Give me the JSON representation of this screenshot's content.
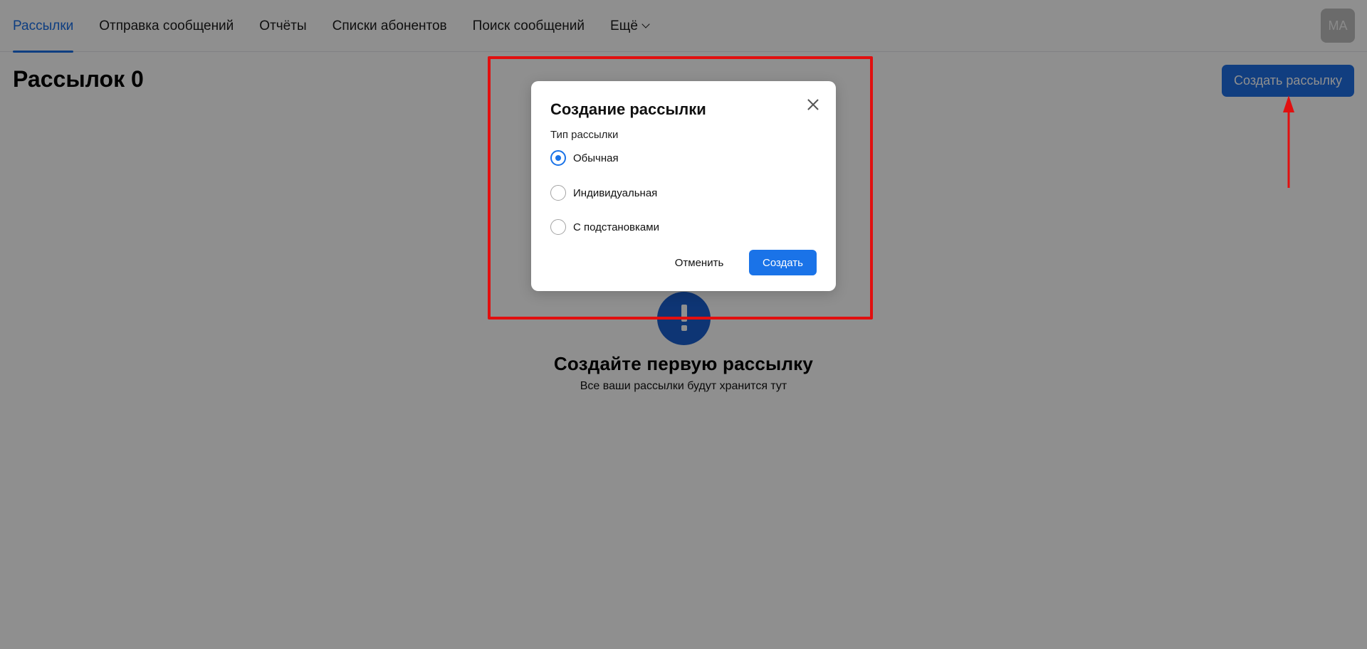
{
  "nav": {
    "tabs": [
      {
        "label": "Рассылки",
        "active": true
      },
      {
        "label": "Отправка сообщений"
      },
      {
        "label": "Отчёты"
      },
      {
        "label": "Списки абонентов"
      },
      {
        "label": "Поиск сообщений"
      },
      {
        "label": "Ещё",
        "icon": "chevron-down-icon"
      }
    ],
    "avatar_initials": "МА"
  },
  "page": {
    "title": "Рассылок 0",
    "create_button": "Создать рассылку"
  },
  "empty_state": {
    "icon": "exclamation-icon",
    "title": "Создайте первую рассылку",
    "subtitle": "Все ваши рассылки будут хранится тут"
  },
  "modal": {
    "title": "Создание рассылки",
    "field_label": "Тип рассылки",
    "options": [
      {
        "label": "Обычная",
        "selected": true
      },
      {
        "label": "Индивидуальная",
        "selected": false
      },
      {
        "label": "С подстановками",
        "selected": false
      }
    ],
    "cancel_label": "Отменить",
    "create_label": "Создать"
  },
  "colors": {
    "accent": "#1a73e8",
    "annotation": "#e10f0f"
  }
}
